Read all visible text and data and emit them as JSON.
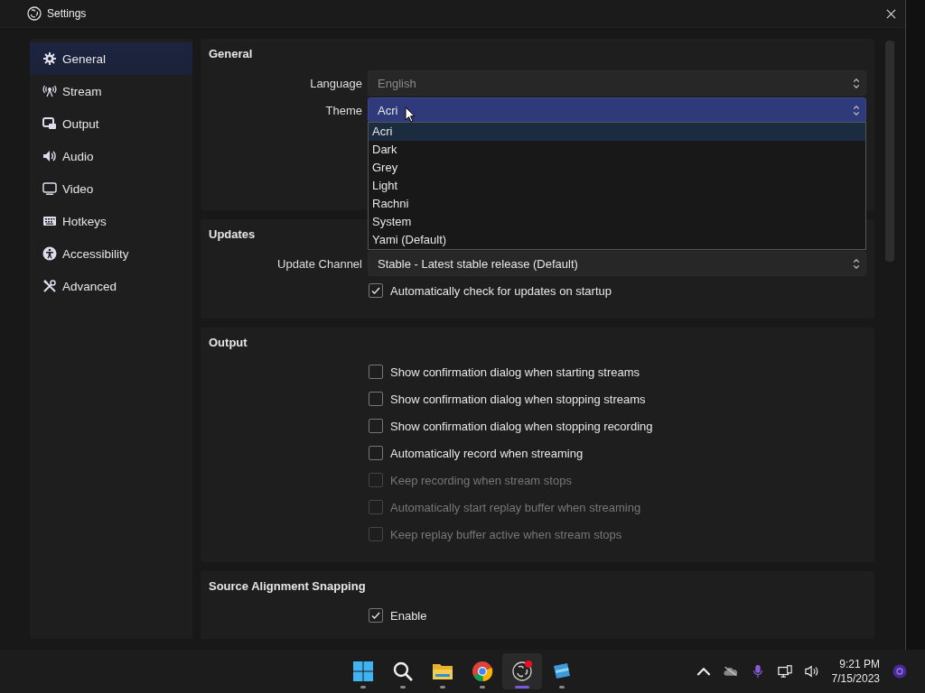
{
  "window": {
    "title": "Settings"
  },
  "sidebar": {
    "items": [
      {
        "label": "General",
        "selected": true
      },
      {
        "label": "Stream",
        "selected": false
      },
      {
        "label": "Output",
        "selected": false
      },
      {
        "label": "Audio",
        "selected": false
      },
      {
        "label": "Video",
        "selected": false
      },
      {
        "label": "Hotkeys",
        "selected": false
      },
      {
        "label": "Accessibility",
        "selected": false
      },
      {
        "label": "Advanced",
        "selected": false
      }
    ]
  },
  "sections": [
    {
      "title": "General",
      "rows": [
        {
          "kind": "select",
          "label": "Language",
          "value": "English",
          "disabled": true,
          "open": false
        },
        {
          "kind": "select",
          "label": "Theme",
          "value": "Acri",
          "disabled": false,
          "open": true,
          "options": [
            {
              "label": "Acri",
              "selected": true
            },
            {
              "label": "Dark",
              "selected": false
            },
            {
              "label": "Grey",
              "selected": false
            },
            {
              "label": "Light",
              "selected": false
            },
            {
              "label": "Rachni",
              "selected": false
            },
            {
              "label": "System",
              "selected": false
            },
            {
              "label": "Yami (Default)",
              "selected": false
            }
          ]
        }
      ]
    },
    {
      "title": "Updates",
      "rows": [
        {
          "kind": "select",
          "label": "Update Channel",
          "value": "Stable - Latest stable release (Default)",
          "disabled": false,
          "open": false
        },
        {
          "kind": "checkbox",
          "label": "Automatically check for updates on startup",
          "checked": true,
          "disabled": false
        }
      ]
    },
    {
      "title": "Output",
      "rows": [
        {
          "kind": "checkbox",
          "label": "Show confirmation dialog when starting streams",
          "checked": false,
          "disabled": false
        },
        {
          "kind": "checkbox",
          "label": "Show confirmation dialog when stopping streams",
          "checked": false,
          "disabled": false
        },
        {
          "kind": "checkbox",
          "label": "Show confirmation dialog when stopping recording",
          "checked": false,
          "disabled": false
        },
        {
          "kind": "checkbox",
          "label": "Automatically record when streaming",
          "checked": false,
          "disabled": false
        },
        {
          "kind": "checkbox",
          "label": "Keep recording when stream stops",
          "checked": false,
          "disabled": true
        },
        {
          "kind": "checkbox",
          "label": "Automatically start replay buffer when streaming",
          "checked": false,
          "disabled": true
        },
        {
          "kind": "checkbox",
          "label": "Keep replay buffer active when stream stops",
          "checked": false,
          "disabled": true
        }
      ]
    },
    {
      "title": "Source Alignment Snapping",
      "rows": [
        {
          "kind": "checkbox",
          "label": "Enable",
          "checked": true,
          "disabled": false
        }
      ]
    }
  ],
  "taskbar": {
    "apps": [
      {
        "kind": "start",
        "active": false
      },
      {
        "kind": "search",
        "active": false
      },
      {
        "kind": "files",
        "active": false
      },
      {
        "kind": "browser",
        "active": false
      },
      {
        "kind": "obs",
        "active": true
      },
      {
        "kind": "game",
        "active": false
      }
    ],
    "time": "9:21 PM",
    "date": "7/15/2023"
  }
}
